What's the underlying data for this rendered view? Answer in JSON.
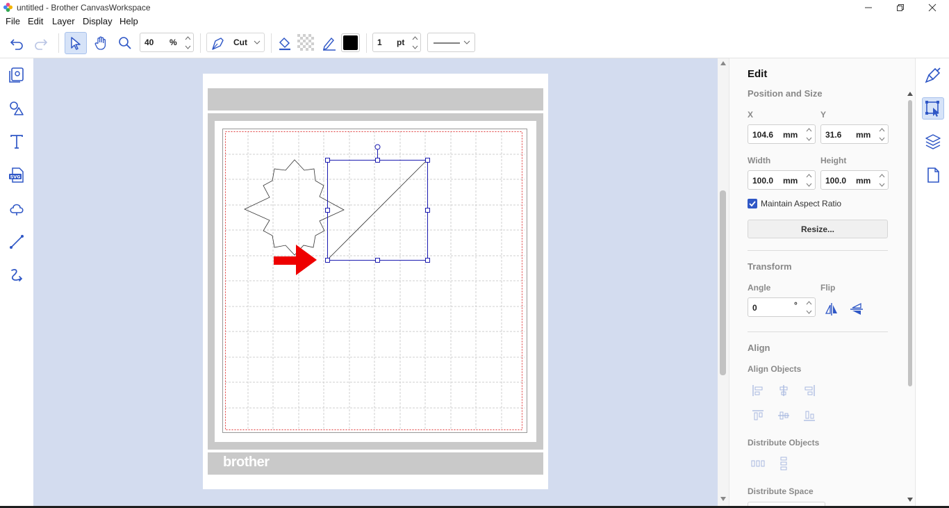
{
  "window": {
    "title": "untitled - Brother CanvasWorkspace"
  },
  "menu": [
    "File",
    "Edit",
    "Layer",
    "Display",
    "Help"
  ],
  "toolbar": {
    "zoom_value": "40",
    "zoom_unit": "%",
    "mode_label": "Cut",
    "line_width_value": "1",
    "line_width_unit": "pt",
    "line_color": "#000000"
  },
  "canvas": {
    "brand_text": "brother"
  },
  "panel": {
    "title": "Edit",
    "position_size": {
      "heading": "Position and Size",
      "x_label": "X",
      "x_value": "104.6",
      "x_unit": "mm",
      "y_label": "Y",
      "y_value": "31.6",
      "y_unit": "mm",
      "width_label": "Width",
      "width_value": "100.0",
      "width_unit": "mm",
      "height_label": "Height",
      "height_value": "100.0",
      "height_unit": "mm",
      "aspect_label": "Maintain Aspect Ratio",
      "aspect_checked": true,
      "resize_label": "Resize..."
    },
    "transform": {
      "heading": "Transform",
      "angle_label": "Angle",
      "angle_value": "0",
      "angle_unit": "°",
      "flip_label": "Flip"
    },
    "align": {
      "heading": "Align",
      "align_objects_label": "Align Objects",
      "distribute_objects_label": "Distribute Objects",
      "distribute_space_label": "Distribute Space"
    }
  },
  "colors": {
    "accent": "#2f57c6",
    "canvas_bg": "#d3dcef",
    "arrow": "#ee0000",
    "selection": "#1a1ab0"
  }
}
